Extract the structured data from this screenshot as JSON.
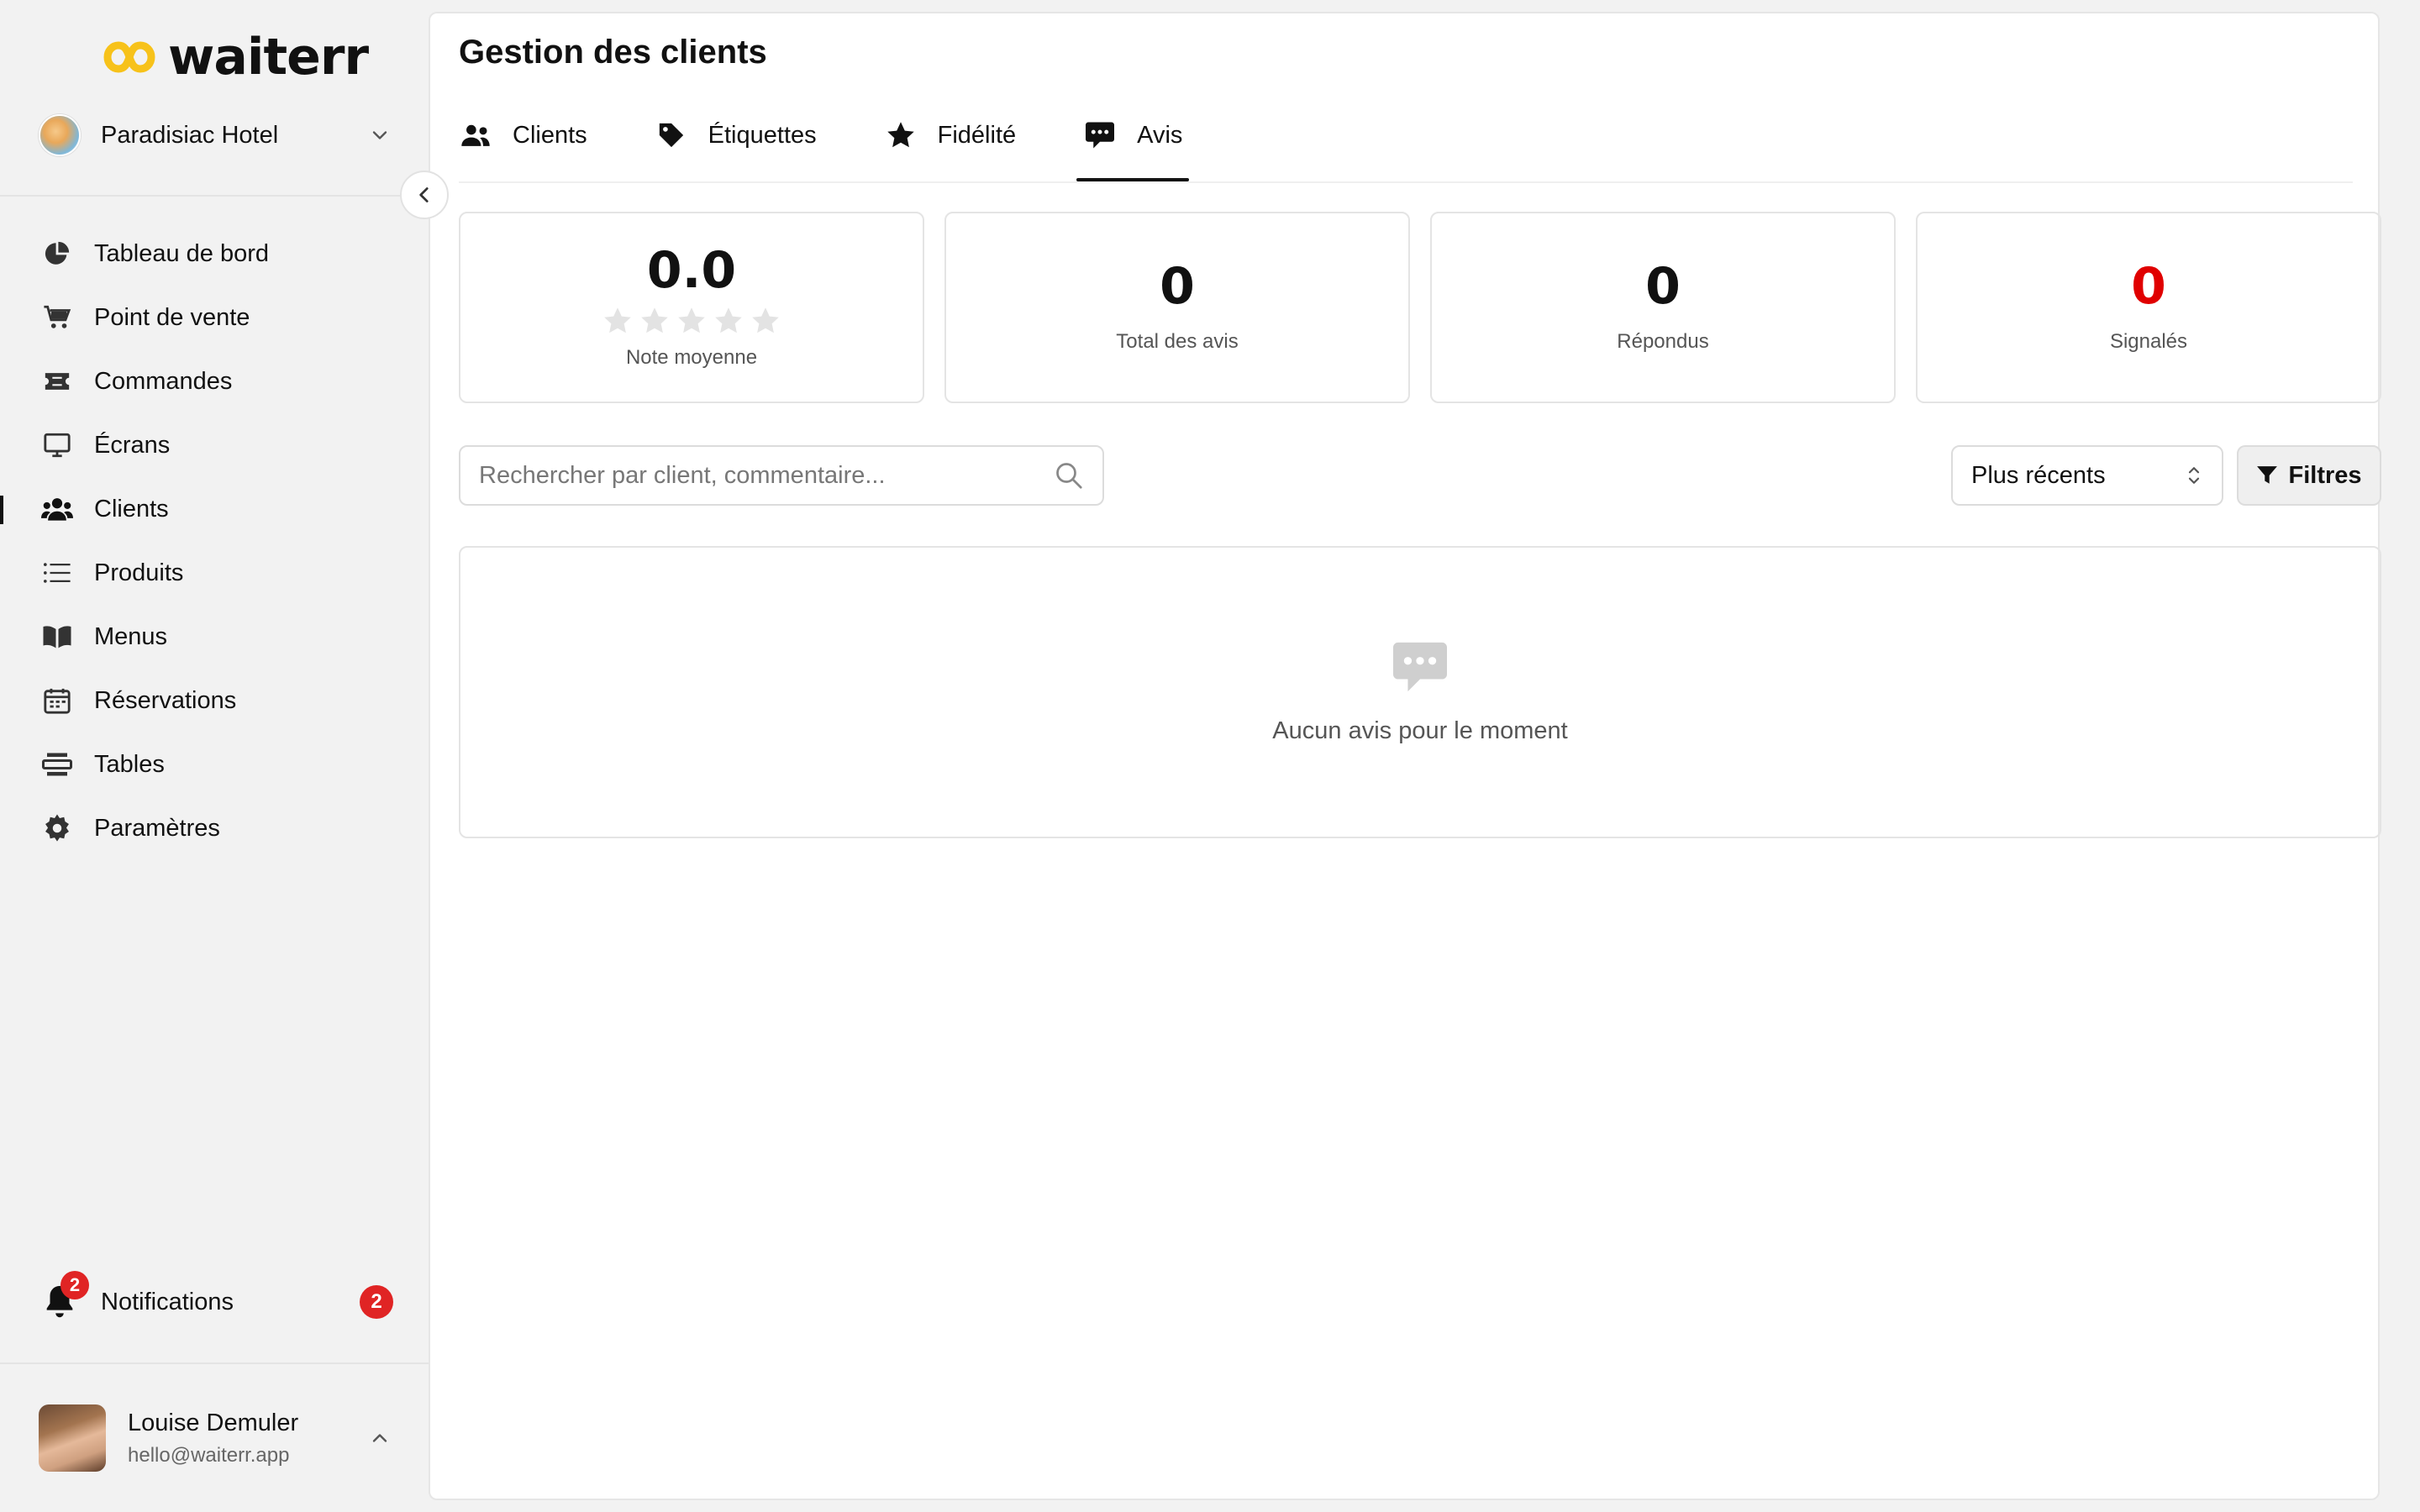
{
  "brand": {
    "name": "waiterr",
    "accent": "#f7c21a"
  },
  "venue": {
    "name": "Paradisiac Hotel"
  },
  "sidebar": {
    "items": [
      {
        "label": "Tableau de bord",
        "icon": "pie-chart-icon"
      },
      {
        "label": "Point de vente",
        "icon": "cart-icon"
      },
      {
        "label": "Commandes",
        "icon": "ticket-icon"
      },
      {
        "label": "Écrans",
        "icon": "monitor-icon"
      },
      {
        "label": "Clients",
        "icon": "users-icon",
        "active": true
      },
      {
        "label": "Produits",
        "icon": "list-icon"
      },
      {
        "label": "Menus",
        "icon": "book-icon"
      },
      {
        "label": "Réservations",
        "icon": "calendar-icon"
      },
      {
        "label": "Tables",
        "icon": "table-icon"
      },
      {
        "label": "Paramètres",
        "icon": "gear-icon"
      }
    ],
    "notifications": {
      "label": "Notifications",
      "badge": "2",
      "count": "2"
    }
  },
  "user": {
    "name": "Louise Demuler",
    "email": "hello@waiterr.app"
  },
  "main": {
    "title": "Gestion des clients",
    "tabs": [
      {
        "label": "Clients",
        "icon": "users-icon"
      },
      {
        "label": "Étiquettes",
        "icon": "tag-icon"
      },
      {
        "label": "Fidélité",
        "icon": "star-icon"
      },
      {
        "label": "Avis",
        "icon": "comment-dots-icon",
        "active": true
      }
    ],
    "stats": [
      {
        "value": "0.0",
        "label": "Note moyenne",
        "rating": 0,
        "max_rating": 5
      },
      {
        "value": "0",
        "label": "Total des avis"
      },
      {
        "value": "0",
        "label": "Répondus"
      },
      {
        "value": "0",
        "label": "Signalés",
        "color": "#e00000"
      }
    ],
    "search": {
      "placeholder": "Rechercher par client, commentaire..."
    },
    "sort": {
      "selected": "Plus récents"
    },
    "filters": {
      "label": "Filtres"
    },
    "empty": {
      "message": "Aucun avis pour le moment"
    }
  }
}
